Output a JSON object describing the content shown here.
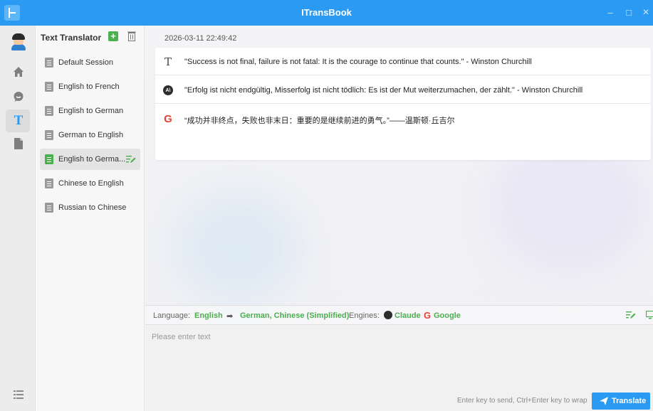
{
  "app": {
    "title": "ITransBook",
    "window_controls": {
      "minimize": "–",
      "maximize": "□",
      "close": "×"
    }
  },
  "rail": {
    "icons": [
      "avatar",
      "home-icon",
      "chat-icon",
      "text-translate-icon",
      "document-icon",
      "menu-list-icon"
    ],
    "active": "text-translate-icon",
    "text_icon_glyph": "T"
  },
  "sessions": {
    "header": "Text Translator",
    "add_glyph": "+",
    "items": [
      {
        "label": "Default Session",
        "active": false
      },
      {
        "label": "English to French",
        "active": false
      },
      {
        "label": "English to German",
        "active": false
      },
      {
        "label": "German to English",
        "active": false
      },
      {
        "label": "English to Germa...",
        "active": true
      },
      {
        "label": "Chinese to English",
        "active": false
      },
      {
        "label": "Russian to Chinese",
        "active": false
      }
    ]
  },
  "main": {
    "timestamp": "2026-03-11 22:49:42",
    "results": [
      {
        "engine_icon": "source-text-icon",
        "glyph": "T",
        "text": "\"Success is not final, failure is not fatal: It is the courage to continue that counts.\" - Winston Churchill"
      },
      {
        "engine_icon": "claude-icon",
        "glyph": "A\\",
        "text": "\"Erfolg ist nicht endgültig, Misserfolg ist nicht tödlich: Es ist der Mut weiterzumachen, der zählt.\" - Winston Churchill"
      },
      {
        "engine_icon": "google-icon",
        "glyph": "G",
        "text": "“成功并非终点，失败也非末日：重要的是继续前进的勇气。”——温斯顿·丘吉尔"
      }
    ]
  },
  "language_bar": {
    "language_label": "Language:",
    "source": "English",
    "arrow": "➡",
    "targets": "German, Chinese (Simplified)",
    "engines_label": "Engines:",
    "engine_1": "Claude",
    "engine_2": "Google"
  },
  "input": {
    "placeholder": "Please enter text",
    "hint": "Enter key to send, Ctrl+Enter key to wrap",
    "translate_label": "Translate"
  },
  "colors": {
    "accent": "#2b9af3",
    "green": "#4caf50",
    "google_blue": "#4285f4",
    "google_red": "#ea4335",
    "google_yellow": "#fbbc05",
    "google_green": "#34a853"
  }
}
